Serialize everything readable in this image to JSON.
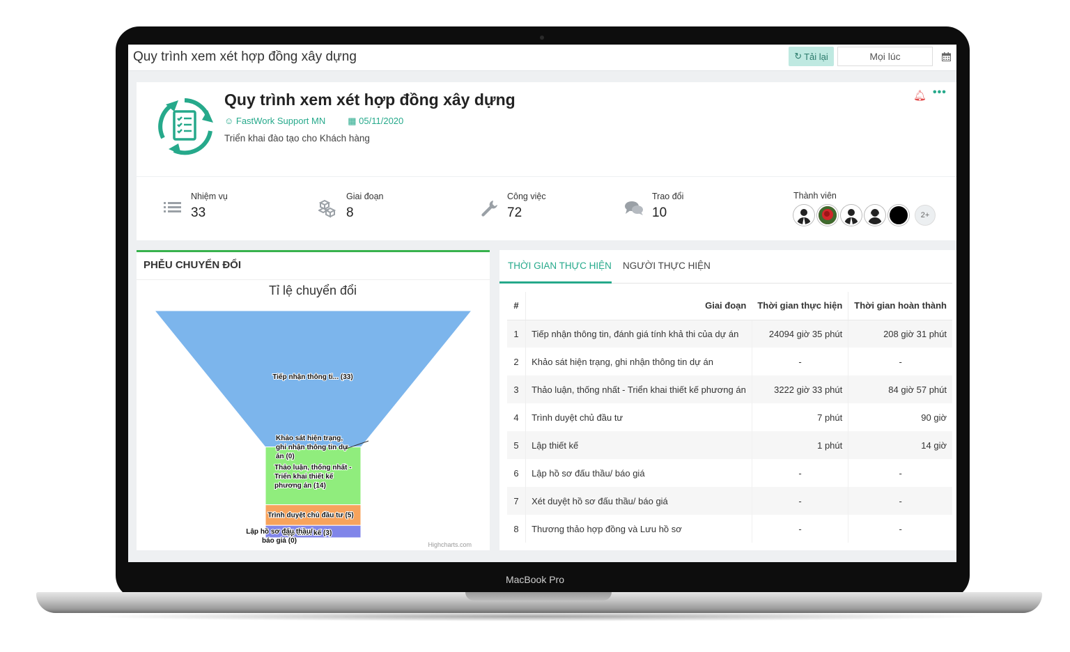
{
  "device": {
    "model": "MacBook Pro"
  },
  "topbar": {
    "title": "Quy trình xem xét hợp đồng xây dựng",
    "reload_label": "Tải lại",
    "period_value": "Mọi lúc"
  },
  "header": {
    "title": "Quy trình xem xét hợp đồng xây dựng",
    "owner": "FastWork Support MN",
    "date": "05/11/2020",
    "description": "Triển khai đào tạo cho Khách hàng"
  },
  "stats": {
    "tasks": {
      "label": "Nhiệm vụ",
      "value": "33"
    },
    "phases": {
      "label": "Giai đoạn",
      "value": "8"
    },
    "jobs": {
      "label": "Công việc",
      "value": "72"
    },
    "discussions": {
      "label": "Trao đổi",
      "value": "10"
    },
    "members": {
      "label": "Thành viên",
      "more": "2+"
    }
  },
  "funnel_panel": {
    "heading": "PHỄU CHUYỂN ĐỔI",
    "credit": "Highcharts.com"
  },
  "chart_data": {
    "type": "funnel",
    "title": "Tỉ lệ chuyển đổi",
    "series": [
      {
        "label": "Tiếp nhận thông ti... (33)",
        "value": 33,
        "color": "#7cb5ec"
      },
      {
        "label": "Khảo sát hiện trạng, ghi nhận thông tin dự án (0)",
        "value": 0,
        "color": "#90ed7d"
      },
      {
        "label": "Thảo luận, thống nhất - Triển khai thiết kế phương án (14)",
        "value": 14,
        "color": "#90ed7d"
      },
      {
        "label": "Trình duyệt chủ đầu tư (5)",
        "value": 5,
        "color": "#f7a35c"
      },
      {
        "label": "Lập thiết kế (3)",
        "value": 3,
        "color": "#8085e9"
      },
      {
        "label": "Lập hồ sơ đấu thầu/ báo giá (0)",
        "value": 0,
        "color": "#f15c80"
      }
    ]
  },
  "tabs": {
    "time": "THỜI GIAN THỰC HIỆN",
    "people": "NGƯỜI THỰC HIỆN"
  },
  "table": {
    "headers": {
      "idx": "#",
      "stage": "Giai đoạn",
      "time": "Thời gian thực hiện",
      "done": "Thời gian hoàn thành"
    },
    "rows": [
      {
        "idx": "1",
        "stage": "Tiếp nhận thông tin, đánh giá tính khả thi của dự án",
        "time": "24094 giờ 35 phút",
        "done": "208 giờ 31 phút"
      },
      {
        "idx": "2",
        "stage": "Khảo sát hiện trạng, ghi nhận thông tin dự án",
        "time": "-",
        "done": "-"
      },
      {
        "idx": "3",
        "stage": "Thảo luận, thống nhất - Triển khai thiết kế phương án",
        "time": "3222 giờ 33 phút",
        "done": "84 giờ 57 phút"
      },
      {
        "idx": "4",
        "stage": "Trình duyệt chủ đầu tư",
        "time": "7 phút",
        "done": "90 giờ"
      },
      {
        "idx": "5",
        "stage": "Lập thiết kế",
        "time": "1 phút",
        "done": "14 giờ"
      },
      {
        "idx": "6",
        "stage": "Lập hồ sơ đấu thầu/ báo giá",
        "time": "-",
        "done": "-"
      },
      {
        "idx": "7",
        "stage": "Xét duyệt hồ sơ đấu thầu/ báo giá",
        "time": "-",
        "done": "-"
      },
      {
        "idx": "8",
        "stage": "Thương thảo hợp đồng và Lưu hồ sơ",
        "time": "-",
        "done": "-"
      }
    ]
  }
}
